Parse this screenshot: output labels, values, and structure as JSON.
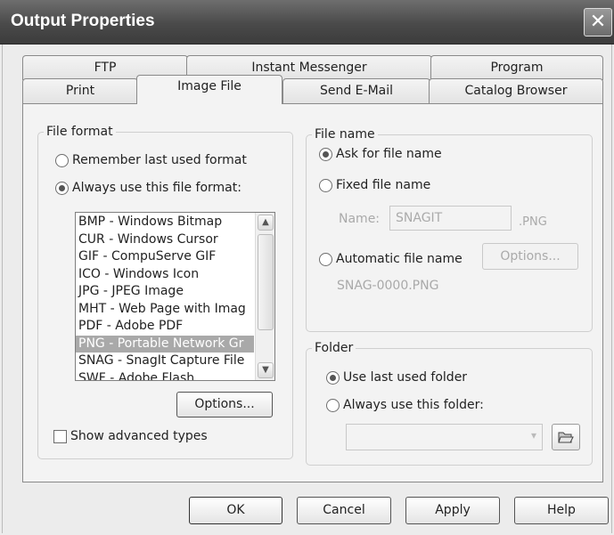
{
  "window": {
    "title": "Output Properties",
    "close_glyph": "✕"
  },
  "tabs": {
    "row_back": [
      {
        "label": "FTP"
      },
      {
        "label": "Instant Messenger"
      },
      {
        "label": "Program"
      }
    ],
    "row_front": [
      {
        "label": "Print"
      },
      {
        "label": "Image File",
        "active": true
      },
      {
        "label": "Send E-Mail"
      },
      {
        "label": "Catalog Browser"
      }
    ]
  },
  "file_format": {
    "legend": "File format",
    "options": [
      {
        "label": "Remember last used format",
        "selected": false
      },
      {
        "label": "Always use this file format:",
        "selected": true
      }
    ],
    "list": [
      "BMP - Windows Bitmap",
      "CUR - Windows Cursor",
      "GIF - CompuServe GIF",
      "ICO - Windows Icon",
      "JPG - JPEG Image",
      "MHT - Web Page with Imag",
      "PDF - Adobe PDF",
      "PNG - Portable Network Gr",
      "SNAG - SnagIt Capture File",
      "SWF - Adobe Flash"
    ],
    "selected_item": "PNG - Portable Network Gr",
    "options_button": "Options...",
    "advanced_checkbox": "Show advanced types"
  },
  "file_name": {
    "legend": "File name",
    "options": [
      {
        "label": "Ask for file name",
        "selected": true
      },
      {
        "label": "Fixed file name",
        "selected": false
      },
      {
        "label": "Automatic file name",
        "selected": false
      }
    ],
    "name_label": "Name:",
    "name_value": "SNAGIT",
    "extension": ".PNG",
    "options_button": "Options...",
    "auto_preview": "SNAG-0000.PNG"
  },
  "folder": {
    "legend": "Folder",
    "options": [
      {
        "label": "Use last used folder",
        "selected": true
      },
      {
        "label": "Always use this folder:",
        "selected": false
      }
    ],
    "folder_value": ""
  },
  "buttons": {
    "ok": "OK",
    "cancel": "Cancel",
    "apply": "Apply",
    "help": "Help"
  },
  "colors": {
    "titlebar": "#4a4a4a",
    "selection": "#a9a9a9",
    "panel": "#f3f3f3"
  }
}
